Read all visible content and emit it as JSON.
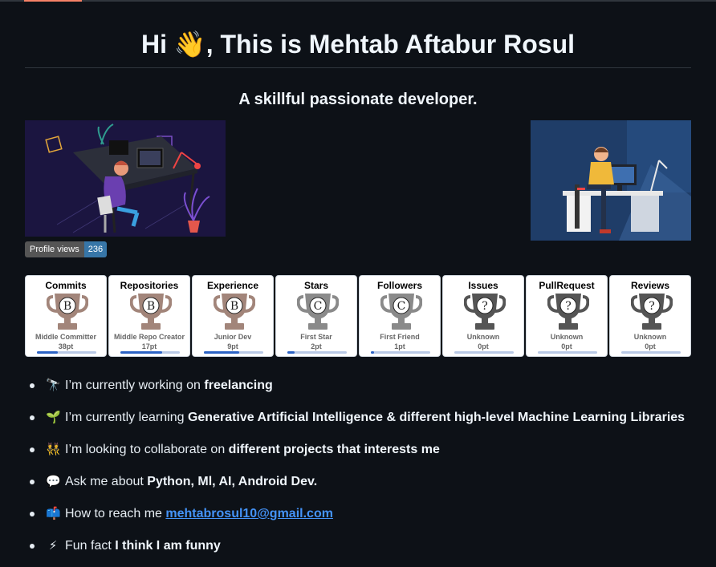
{
  "header": {
    "title": "Hi 👋, This is Mehtab Aftabur Rosul",
    "subtitle": "A skillful passionate developer."
  },
  "images": {
    "left": "developer-at-desk-illustration",
    "right": "developer-at-computer-illustration"
  },
  "profile_views": {
    "label": "Profile views",
    "value": "236",
    "accent": "#3776a8"
  },
  "trophies": [
    {
      "title": "Commits",
      "rank": "B",
      "name": "Middle Committer",
      "points": "38pt",
      "progress": 0.35,
      "color": "#a2857a"
    },
    {
      "title": "Repositories",
      "rank": "B",
      "name": "Middle Repo Creator",
      "points": "17pt",
      "progress": 0.7,
      "color": "#a2857a"
    },
    {
      "title": "Experience",
      "rank": "B",
      "name": "Junior Dev",
      "points": "9pt",
      "progress": 0.6,
      "color": "#a2857a"
    },
    {
      "title": "Stars",
      "rank": "C",
      "name": "First Star",
      "points": "2pt",
      "progress": 0.12,
      "color": "#8a8a8a"
    },
    {
      "title": "Followers",
      "rank": "C",
      "name": "First Friend",
      "points": "1pt",
      "progress": 0.05,
      "color": "#8a8a8a"
    },
    {
      "title": "Issues",
      "rank": "?",
      "name": "Unknown",
      "points": "0pt",
      "progress": 0,
      "color": "#555555"
    },
    {
      "title": "PullRequest",
      "rank": "?",
      "name": "Unknown",
      "points": "0pt",
      "progress": 0,
      "color": "#555555"
    },
    {
      "title": "Reviews",
      "rank": "?",
      "name": "Unknown",
      "points": "0pt",
      "progress": 0,
      "color": "#555555"
    }
  ],
  "facts": [
    {
      "icon": "🔭",
      "text": "I’m currently working on ",
      "bold": "freelancing"
    },
    {
      "icon": "🌱",
      "text": "I’m currently learning ",
      "bold": "Generative Artificial Intelligence & different high-level Machine Learning Libraries"
    },
    {
      "icon": "👯",
      "text": "I’m looking to collaborate on ",
      "bold": "different projects that interests me"
    },
    {
      "icon": "💬",
      "text": "Ask me about ",
      "bold": "Python, Ml, AI, Android Dev."
    },
    {
      "icon": "📫",
      "text": "How to reach me ",
      "link": "mehtabrosul10@gmail.com"
    },
    {
      "icon": "⚡",
      "text": "Fun fact ",
      "bold": "I think I am funny"
    }
  ]
}
